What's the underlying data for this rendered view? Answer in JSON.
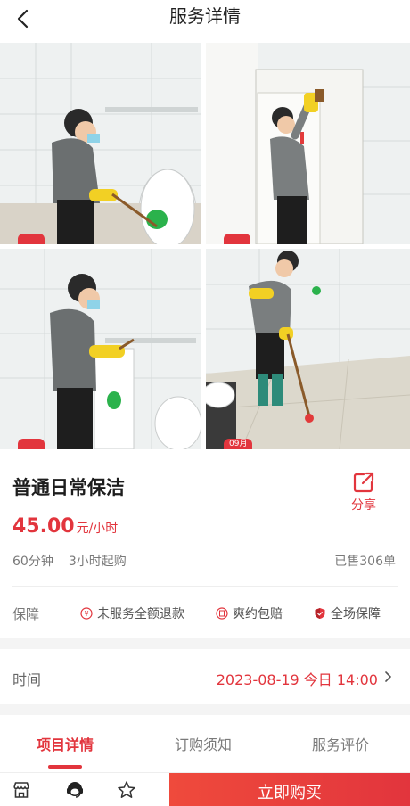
{
  "header": {
    "title": "服务详情",
    "back_icon": "chevron-left-icon"
  },
  "gallery": {
    "badges": [
      "",
      "",
      "",
      "09月"
    ]
  },
  "product": {
    "title": "普通日常保洁",
    "price_value": "45.00",
    "price_unit": "元/小时",
    "duration": "60分钟",
    "min_order": "3小时起购",
    "sold": "已售306单",
    "share_label": "分享"
  },
  "guarantee": {
    "label": "保障",
    "items": [
      "未服务全额退款",
      "爽约包赔",
      "全场保障"
    ]
  },
  "time": {
    "label": "时间",
    "value": "2023-08-19 今日 14:00"
  },
  "tabs": [
    "项目详情",
    "订购须知",
    "服务评价"
  ],
  "bottom": {
    "buy_label": "立即购买"
  },
  "colors": {
    "accent": "#e2353d"
  }
}
